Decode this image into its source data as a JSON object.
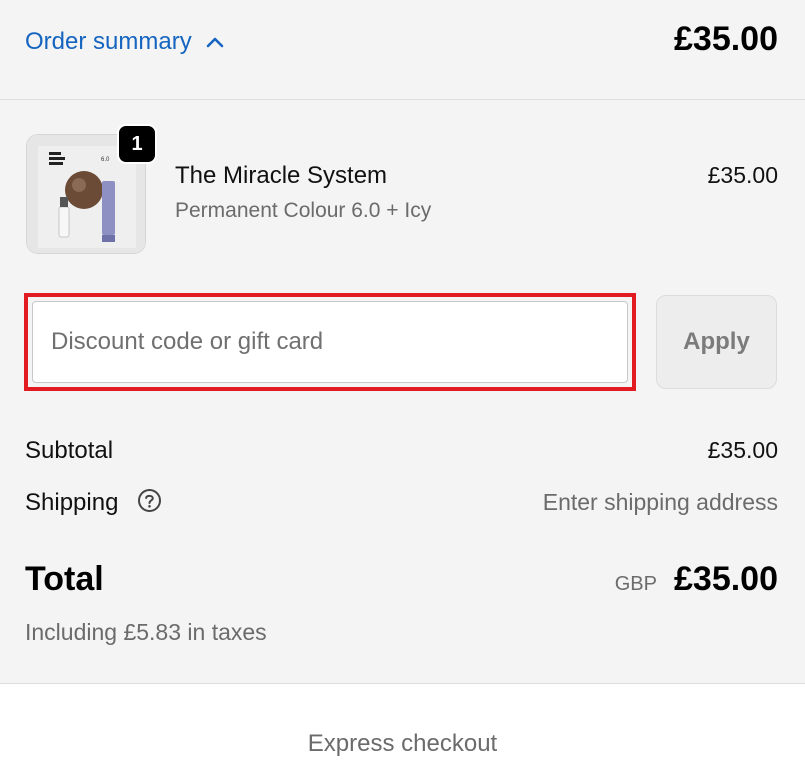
{
  "header": {
    "toggle_label": "Order summary",
    "total": "£35.00"
  },
  "line_item": {
    "quantity": "1",
    "name": "The Miracle System",
    "variant": "Permanent Colour 6.0 + Icy",
    "price": "£35.00",
    "image_box_text": "6.0"
  },
  "discount": {
    "placeholder": "Discount code or gift card",
    "value": "",
    "apply_label": "Apply"
  },
  "costs": {
    "subtotal_label": "Subtotal",
    "subtotal_value": "£35.00",
    "shipping_label": "Shipping",
    "shipping_value": "Enter shipping address"
  },
  "total": {
    "label": "Total",
    "currency": "GBP",
    "value": "£35.00",
    "tax_note": "Including £5.83 in taxes"
  },
  "express": {
    "label": "Express checkout"
  },
  "colors": {
    "link": "#1565c0",
    "highlight_border": "#e21b23",
    "summary_background": "#f4f4f4"
  },
  "icons": {
    "toggle": "chevron-up-icon",
    "shipping_help": "question-circle-icon"
  }
}
